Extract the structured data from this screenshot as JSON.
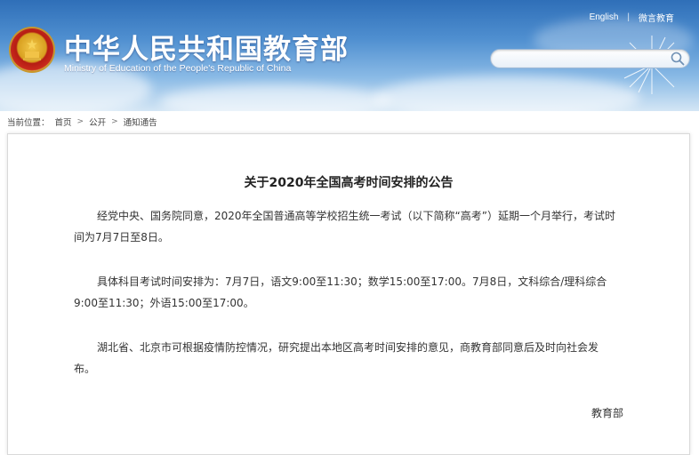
{
  "header": {
    "title": "中华人民共和国教育部",
    "subtitle": "Ministry of Education of the People's Republic of China",
    "links": {
      "english": "English",
      "separator": "|",
      "weixin": "微言教育"
    },
    "search": {
      "placeholder": "",
      "value": ""
    }
  },
  "breadcrumb": {
    "label": "当前位置：",
    "items": [
      "首页",
      "公开",
      "通知通告"
    ],
    "separator": ">"
  },
  "article": {
    "title": "关于2020年全国高考时间安排的公告",
    "paragraphs": [
      "经党中央、国务院同意，2020年全国普通高等学校招生统一考试（以下简称“高考”）延期一个月举行，考试时间为7月7日至8日。",
      "具体科目考试时间安排为：7月7日，语文9:00至11:30；数学15:00至17:00。7月8日，文科综合/理科综合9:00至11:30；外语15:00至17:00。",
      "湖北省、北京市可根据疫情防控情况，研究提出本地区高考时间安排的意见，商教育部同意后及时向社会发布。"
    ],
    "signature": "教育部"
  },
  "colors": {
    "banner": "#2f6fb8",
    "accent": "#c92a1c"
  }
}
